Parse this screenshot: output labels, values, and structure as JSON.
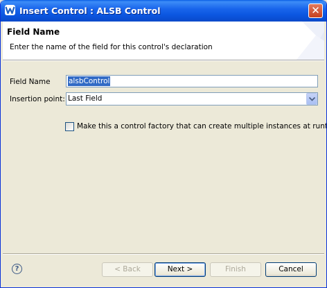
{
  "window": {
    "title": "Insert Control : ALSB Control",
    "app_icon": "weblogic-icon",
    "close_glyph": "✕"
  },
  "banner": {
    "title": "Field Name",
    "description": "Enter the name of the field for this control's declaration"
  },
  "form": {
    "field_name_label": "Field Name",
    "field_name_value": "alsbControl",
    "insertion_point_label": "Insertion point:",
    "insertion_point_value": "Last Field",
    "factory_checkbox_label": "Make this a control factory that can create multiple instances at runtime",
    "factory_checkbox_checked": false
  },
  "footer": {
    "help_glyph": "?",
    "back_label": "< Back",
    "next_label": "Next >",
    "finish_label": "Finish",
    "cancel_label": "Cancel"
  },
  "colors": {
    "titlebar": "#0b56e0",
    "dialog_background": "#ece9d8",
    "selection": "#316ac5"
  }
}
